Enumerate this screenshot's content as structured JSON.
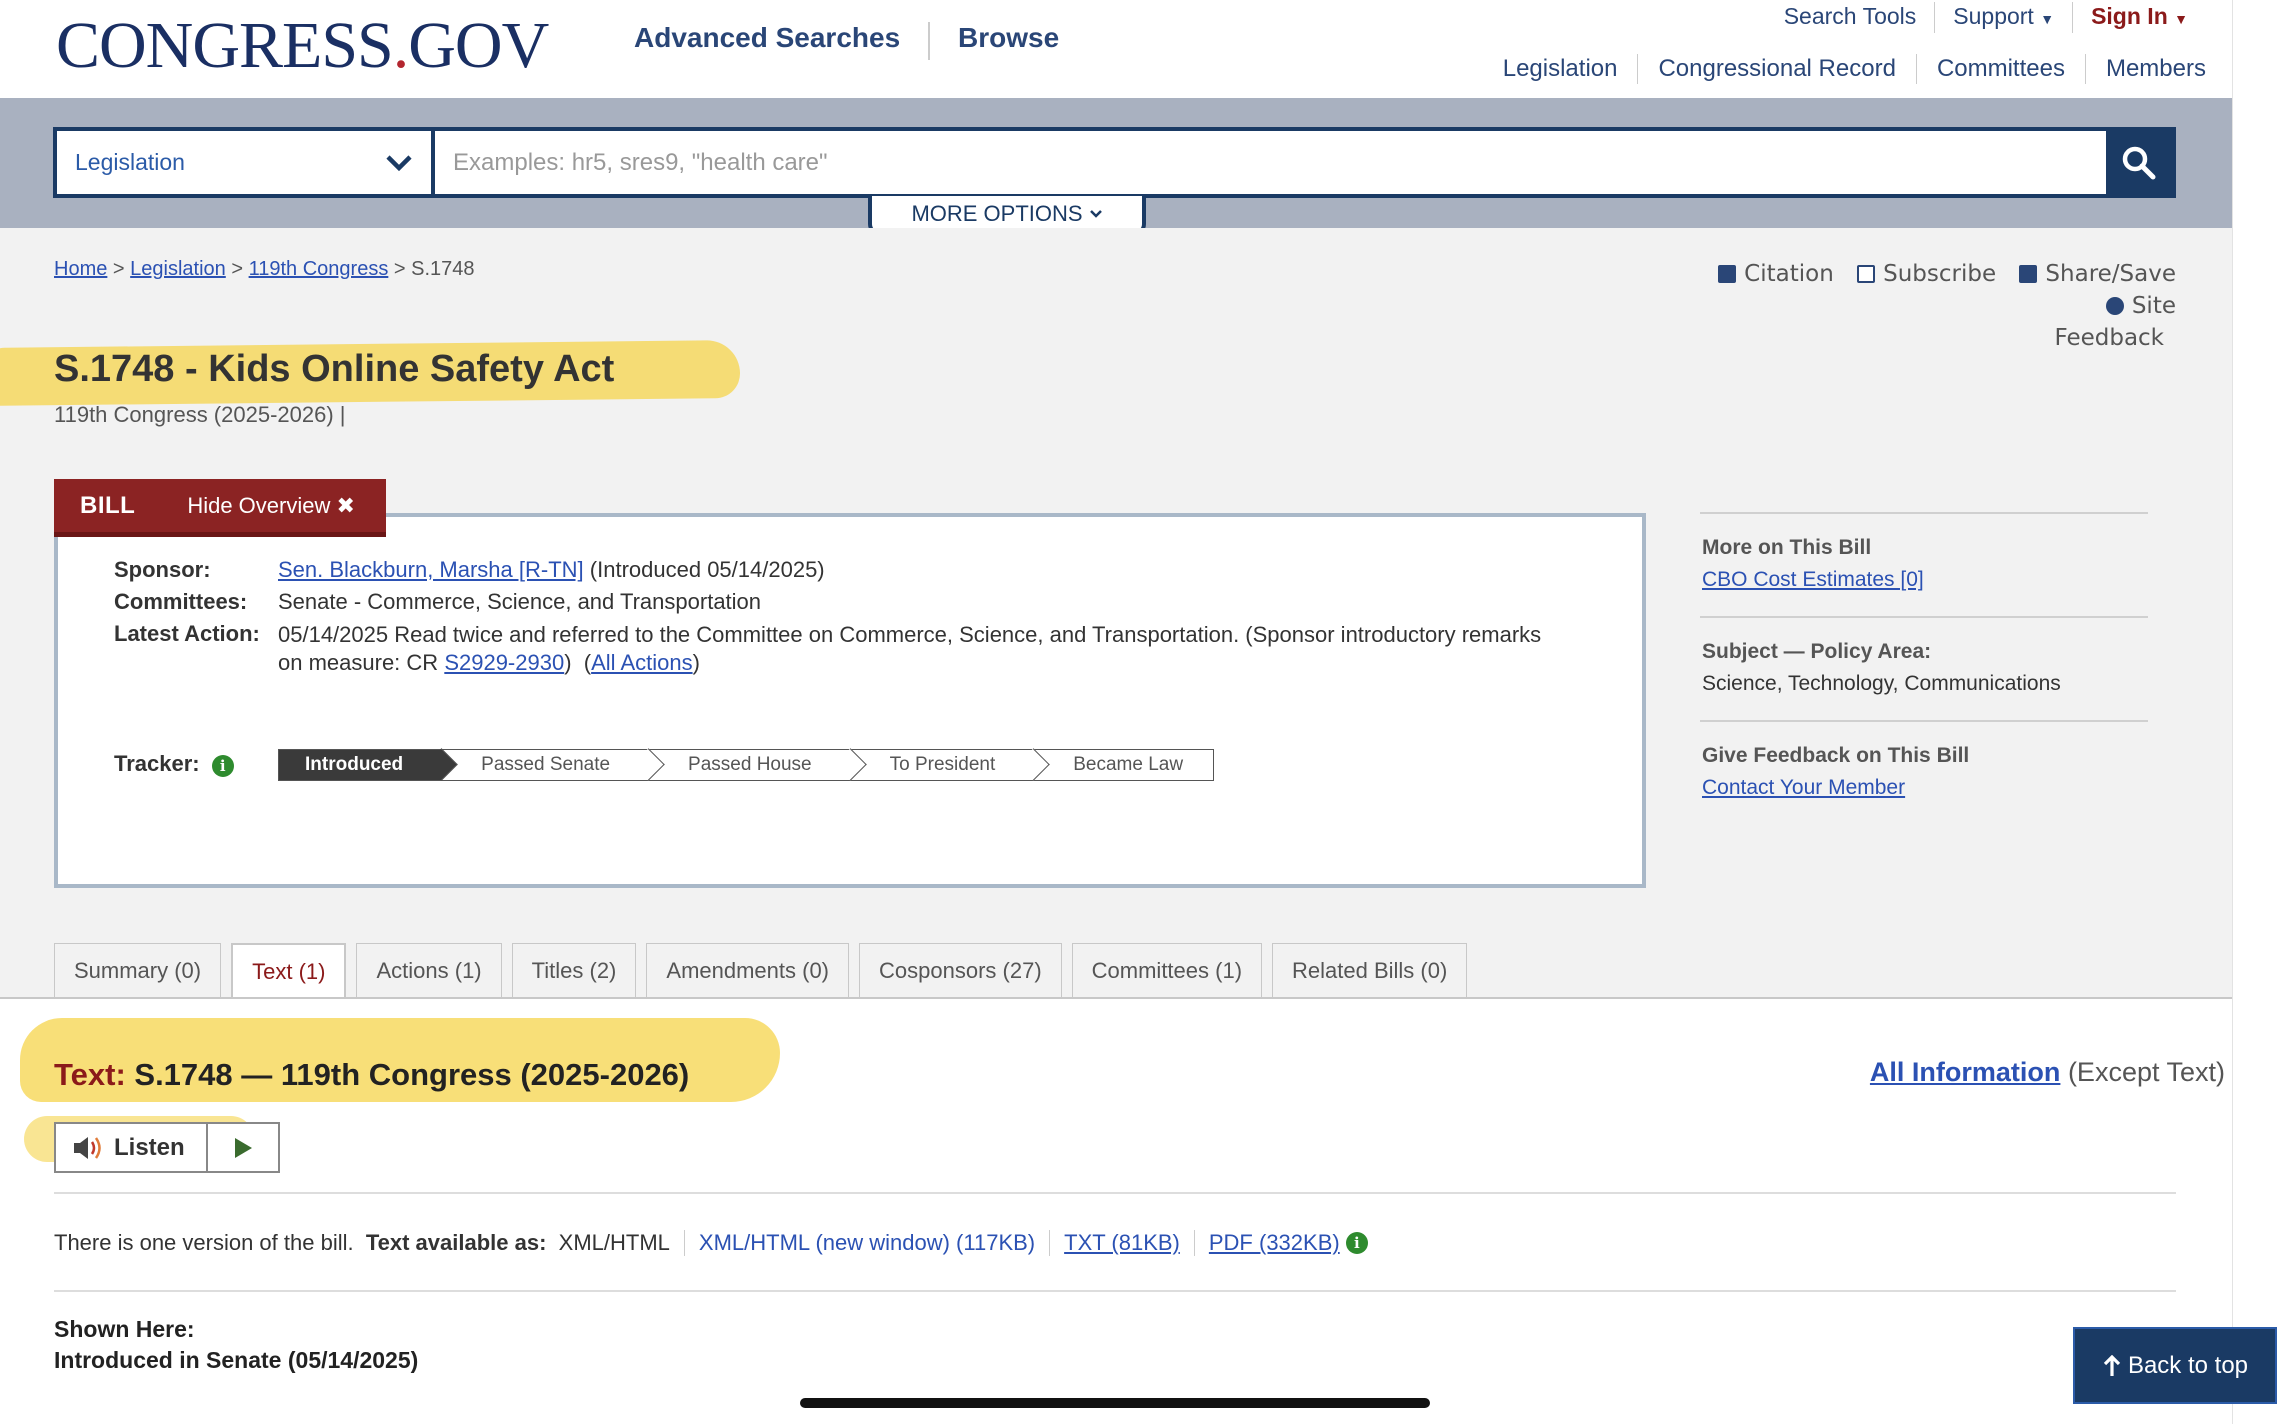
{
  "header": {
    "logo_main": "CONGRESS",
    "logo_dot": ".",
    "logo_tld": "GOV",
    "nav_advanced": "Advanced Searches",
    "nav_browse": "Browse",
    "top_links": [
      "Search Tools",
      "Support",
      "Sign In"
    ],
    "main_links": [
      "Legislation",
      "Congressional Record",
      "Committees",
      "Members"
    ]
  },
  "search": {
    "scope": "Legislation",
    "placeholder": "Examples: hr5, sres9, \"health care\"",
    "more_options": "MORE OPTIONS"
  },
  "breadcrumb": {
    "items": [
      "Home",
      "Legislation",
      "119th Congress"
    ],
    "sep": ">",
    "current": "S.1748"
  },
  "tools": {
    "citation": "Citation",
    "subscribe": "Subscribe",
    "share": "Share/Save",
    "feedback_1": "Site",
    "feedback_2": "Feedback"
  },
  "bill": {
    "title": "S.1748 - Kids Online Safety Act",
    "congress": "119th Congress (2025-2026) |",
    "tab_label": "BILL",
    "hide_overview": "Hide Overview"
  },
  "overview": {
    "sponsor_label": "Sponsor:",
    "sponsor_name": "Sen. Blackburn, Marsha [R-TN]",
    "sponsor_intro": "(Introduced 05/14/2025)",
    "committees_label": "Committees:",
    "committees_value": "Senate - Commerce, Science, and Transportation",
    "latest_label": "Latest Action:",
    "latest_line1": "05/14/2025 Read twice and referred to the Committee on Commerce, Science, and Transportation. (Sponsor introductory remarks",
    "latest_line2_pre": "on measure: CR",
    "latest_cr_link": "S2929-2930",
    "latest_all_actions": "All Actions",
    "tracker_label": "Tracker:",
    "tracker_steps": [
      "Introduced",
      "Passed Senate",
      "Passed House",
      "To President",
      "Became Law"
    ]
  },
  "sidebar": {
    "more_title": "More on This Bill",
    "more_link": "CBO Cost Estimates [0]",
    "subject_title": "Subject — Policy Area:",
    "subject_value": "Science, Technology, Communications",
    "feedback_title": "Give Feedback on This Bill",
    "feedback_link": "Contact Your Member"
  },
  "tabs": [
    "Summary (0)",
    "Text (1)",
    "Actions (1)",
    "Titles (2)",
    "Amendments (0)",
    "Cosponsors (27)",
    "Committees (1)",
    "Related Bills (0)"
  ],
  "text_section": {
    "heading_label": "Text:",
    "heading_rest": "S.1748 — 119th Congress (2025-2026)",
    "all_info_link": "All Information",
    "all_info_rest": "(Except Text)",
    "listen": "Listen",
    "versions_intro": "There is one version of the bill.",
    "available_label": "Text available as:",
    "format_current": "XML/HTML",
    "format_new_window": "XML/HTML (new window) (117KB)",
    "format_txt": "TXT (81KB)",
    "format_pdf": "PDF (332KB)",
    "shown_here_label": "Shown Here:",
    "shown_here_value": "Introduced in Senate (05/14/2025)"
  },
  "back_to_top": "Back to top",
  "colors": {
    "navy": "#1a3a64",
    "maroon": "#8b2323",
    "link": "#2b51b3",
    "highlight": "#f5d44b"
  }
}
